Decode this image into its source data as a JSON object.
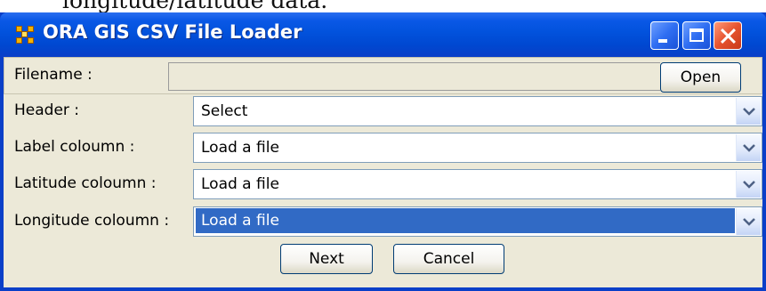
{
  "document": {
    "partial_text_line": "longitude/latitude data."
  },
  "window": {
    "title": "ORA GIS CSV File Loader",
    "icon": "ora-app-icon",
    "controls": [
      "minimize-icon",
      "maximize-icon",
      "close-icon"
    ]
  },
  "form": {
    "filename": {
      "label": "Filename :",
      "value": "",
      "open_label": "Open"
    },
    "header": {
      "label": "Header :",
      "selected": "Select"
    },
    "label_column": {
      "label": "Label coloumn :",
      "selected": "Load a file"
    },
    "latitude_column": {
      "label": "Latitude coloumn :",
      "selected": "Load a file"
    },
    "longitude_column": {
      "label": "Longitude coloumn :",
      "selected": "Load a file"
    }
  },
  "buttons": {
    "next_label": "Next",
    "cancel_label": "Cancel"
  },
  "colors": {
    "titlebar": "#0252dc",
    "client_background": "#ece9d8",
    "selection": "#316ac5",
    "close_button": "#e6532e"
  }
}
